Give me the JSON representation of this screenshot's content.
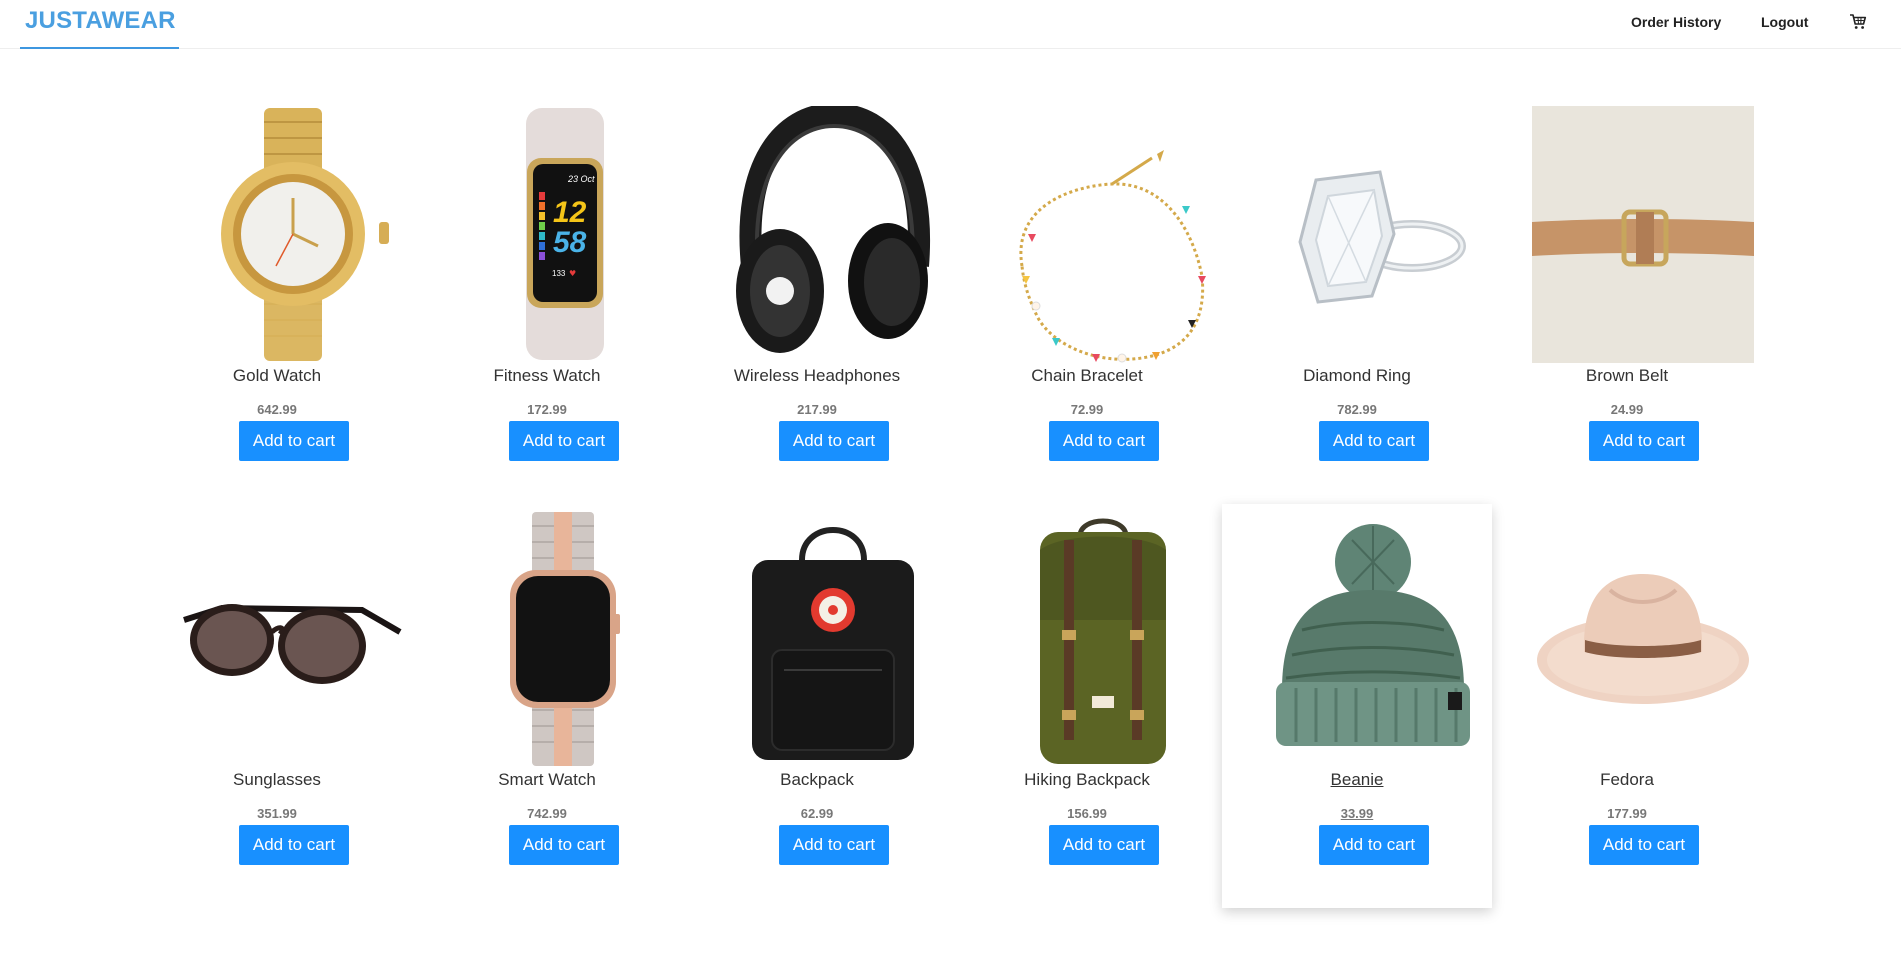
{
  "header": {
    "logo": "JUSTAWEAR",
    "nav": {
      "order_history": "Order History",
      "logout": "Logout"
    },
    "cart_icon": "cart-icon"
  },
  "colors": {
    "accent": "#1890ff",
    "logo": "#4a9fe0",
    "price": "#777777"
  },
  "products": [
    {
      "name": "Gold Watch",
      "price": "642.99",
      "button": "Add to cart",
      "image_icon": "gold-watch-image"
    },
    {
      "name": "Fitness Watch",
      "price": "172.99",
      "button": "Add to cart",
      "image_icon": "fitness-watch-image",
      "image_text": {
        "date": "23 Oct",
        "hour": "12",
        "minute": "58",
        "steps": "133"
      }
    },
    {
      "name": "Wireless Headphones",
      "price": "217.99",
      "button": "Add to cart",
      "image_icon": "headphones-image"
    },
    {
      "name": "Chain Bracelet",
      "price": "72.99",
      "button": "Add to cart",
      "image_icon": "bracelet-image"
    },
    {
      "name": "Diamond Ring",
      "price": "782.99",
      "button": "Add to cart",
      "image_icon": "ring-image"
    },
    {
      "name": "Brown Belt",
      "price": "24.99",
      "button": "Add to cart",
      "image_icon": "belt-image"
    },
    {
      "name": "Sunglasses",
      "price": "351.99",
      "button": "Add to cart",
      "image_icon": "sunglasses-image"
    },
    {
      "name": "Smart Watch",
      "price": "742.99",
      "button": "Add to cart",
      "image_icon": "smart-watch-image"
    },
    {
      "name": "Backpack",
      "price": "62.99",
      "button": "Add to cart",
      "image_icon": "backpack-image"
    },
    {
      "name": "Hiking Backpack",
      "price": "156.99",
      "button": "Add to cart",
      "image_icon": "hiking-backpack-image"
    },
    {
      "name": "Beanie",
      "price": "33.99",
      "button": "Add to cart",
      "image_icon": "beanie-image",
      "hovered": true
    },
    {
      "name": "Fedora",
      "price": "177.99",
      "button": "Add to cart",
      "image_icon": "fedora-image"
    }
  ]
}
